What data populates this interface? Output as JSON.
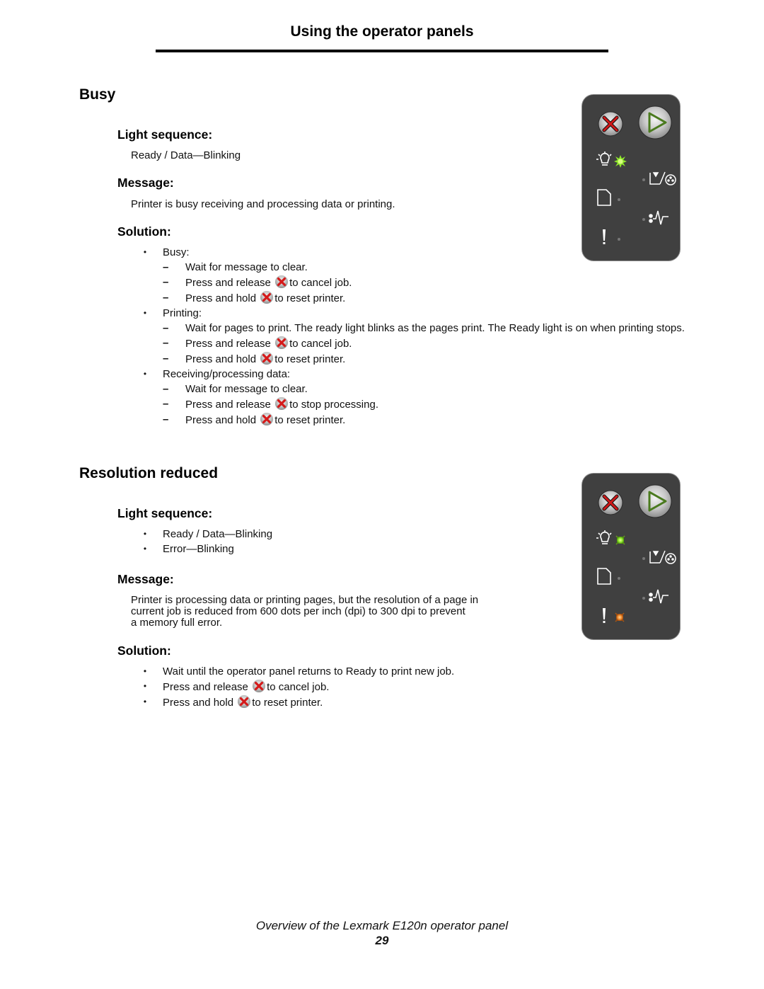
{
  "header": {
    "title": "Using the operator panels"
  },
  "sections": [
    {
      "title": "Busy",
      "light_sequence": {
        "heading": "Light sequence:",
        "text": "Ready / Data—Blinking"
      },
      "message": {
        "heading": "Message:",
        "text": "Printer is busy receiving and processing data or printing."
      },
      "solution": {
        "heading": "Solution:",
        "groups": [
          {
            "label": "Busy:",
            "items": [
              {
                "pre": "Wait for message to clear.",
                "post": ""
              },
              {
                "pre": "Press and release",
                "post": "to cancel job."
              },
              {
                "pre": "Press and hold",
                "post": "to reset printer."
              }
            ]
          },
          {
            "label": "Printing:",
            "items": [
              {
                "pre": "Wait for pages to print. The ready light blinks as the pages print. The Ready light is on when printing stops.",
                "post": ""
              },
              {
                "pre": "Press and release",
                "post": "to cancel job."
              },
              {
                "pre": "Press and hold",
                "post": "to reset printer."
              }
            ]
          },
          {
            "label": "Receiving/processing data:",
            "items": [
              {
                "pre": "Wait for message to clear.",
                "post": ""
              },
              {
                "pre": "Press and release",
                "post": "to stop processing."
              },
              {
                "pre": "Press and hold",
                "post": "to reset printer."
              }
            ]
          }
        ]
      },
      "panel": {
        "buttons": [
          "cancel-button",
          "continue-button"
        ],
        "lights": {
          "ready_data": "blinking",
          "toner": "off",
          "load_paper": "off",
          "paper_jam": "off",
          "error": "off"
        }
      }
    },
    {
      "title": "Resolution reduced",
      "light_sequence": {
        "heading": "Light sequence:",
        "items": [
          "Ready / Data—Blinking",
          "Error—Blinking"
        ]
      },
      "message": {
        "heading": "Message:",
        "lines": [
          "Printer is processing data or printing pages, but the resolution of a page in",
          "current job is reduced from 600 dots per inch (dpi) to 300 dpi to prevent",
          "a memory full error."
        ]
      },
      "solution": {
        "heading": "Solution:",
        "items": [
          {
            "pre": "Wait until the operator panel returns to Ready to print new job.",
            "post": ""
          },
          {
            "pre": "Press and release",
            "post": "to cancel job."
          },
          {
            "pre": "Press and hold",
            "post": "to reset printer."
          }
        ]
      },
      "panel": {
        "buttons": [
          "cancel-button",
          "continue-button"
        ],
        "lights": {
          "ready_data": "blinking",
          "toner": "off",
          "load_paper": "off",
          "paper_jam": "off",
          "error": "blinking"
        }
      }
    }
  ],
  "colors": {
    "panel_bg": "#404040",
    "ready_light": "#8fe82a",
    "error_light": "#f08a2c",
    "cancel_x": "#d02020",
    "continue_arrow": "#4a7a1e"
  },
  "footer": {
    "title": "Overview of the Lexmark E120n operator panel",
    "page": "29"
  }
}
